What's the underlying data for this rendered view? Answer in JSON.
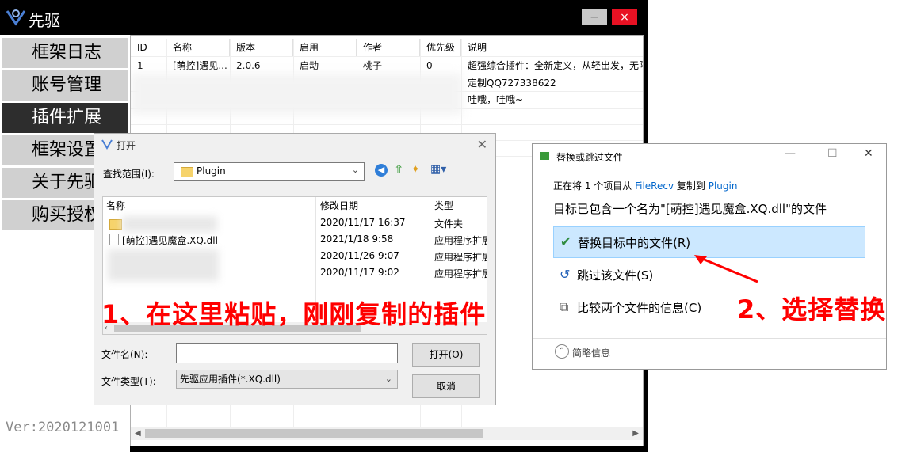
{
  "app": {
    "title": "先驱",
    "min_label": "−",
    "close_label": "×",
    "version": "Ver:2020121001"
  },
  "sidebar": {
    "items": [
      {
        "label": "框架日志"
      },
      {
        "label": "账号管理"
      },
      {
        "label": "插件扩展"
      },
      {
        "label": "框架设置"
      },
      {
        "label": "关于先驱"
      },
      {
        "label": "购买授权"
      }
    ]
  },
  "plugin_table": {
    "headers": [
      "ID",
      "名称",
      "版本",
      "启用",
      "作者",
      "优先级",
      "说明"
    ],
    "row": [
      "1",
      "[萌控]遇见...",
      "2.0.6",
      "启动",
      "桃子",
      "0",
      "超强综合插件：全新定义，从轻出发，无限"
    ],
    "desc_lines": [
      "定制QQ727338622",
      "哇哦，哇哦~"
    ]
  },
  "open_dialog": {
    "title": "打开",
    "lookin_label": "查找范围(I):",
    "lookin_value": "Plugin",
    "headers": [
      "名称",
      "修改日期",
      "类型"
    ],
    "files": [
      {
        "name": "",
        "date": "2020/11/17 16:37",
        "type": "文件夹"
      },
      {
        "name": "[萌控]遇见魔盒.XQ.dll",
        "date": "2021/1/18 9:58",
        "type": "应用程序扩展"
      },
      {
        "name": "",
        "date": "2020/11/26 9:07",
        "type": "应用程序扩展"
      },
      {
        "name": "",
        "date": "2020/11/17 9:02",
        "type": "应用程序扩展"
      }
    ],
    "filename_label": "文件名(N):",
    "filename_value": "",
    "filetype_label": "文件类型(T):",
    "filetype_value": "先驱应用插件(*.XQ.dll)",
    "open_button": "打开(O)",
    "cancel_button": "取消"
  },
  "replace_dialog": {
    "title": "替换或跳过文件",
    "info_prefix": "正在将 1 个项目从 ",
    "info_src": "FileRecv",
    "info_mid": " 复制到 ",
    "info_dst": "Plugin",
    "destination_text": "目标已包含一个名为\"[萌控]遇见魔盒.XQ.dll\"的文件",
    "options": [
      {
        "label": "替换目标中的文件(R)"
      },
      {
        "label": "跳过该文件(S)"
      },
      {
        "label": "比较两个文件的信息(C)"
      }
    ],
    "more_info": "简略信息"
  },
  "annotations": {
    "step1": "1、在这里粘贴，刚刚复制的插件",
    "step2": "2、选择替换"
  },
  "colors": {
    "annotation": "#ff0000",
    "selected_option": "#cce8ff",
    "link": "#0066cc"
  }
}
